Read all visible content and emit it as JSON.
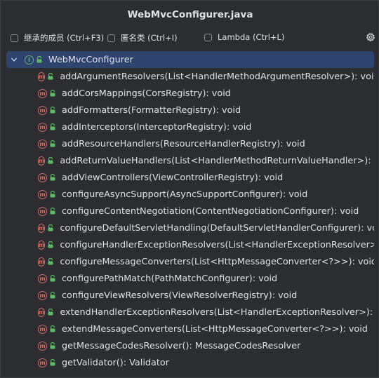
{
  "window": {
    "title": "WebMvcConfigurer.java"
  },
  "options": {
    "inherited": "继承的成员 (Ctrl+F3)",
    "anonymous": "匿名类 (Ctrl+I)",
    "lambda": "Lambda (Ctrl+L)"
  },
  "icons": {
    "class": "interface-icon",
    "method": "method-icon",
    "access": "public-lock-icon",
    "settings": "gear-icon"
  },
  "colors": {
    "selection": "#2e436e",
    "class_icon": "#5fb865",
    "method_icon": "#d86b60",
    "access_icon": "#5fb865"
  },
  "tree": {
    "root": {
      "badge": "I",
      "label": "WebMvcConfigurer"
    },
    "method_badge": "m",
    "methods": [
      "addArgumentResolvers(List<HandlerMethodArgumentResolver>): void",
      "addCorsMappings(CorsRegistry): void",
      "addFormatters(FormatterRegistry): void",
      "addInterceptors(InterceptorRegistry): void",
      "addResourceHandlers(ResourceHandlerRegistry): void",
      "addReturnValueHandlers(List<HandlerMethodReturnValueHandler>): void",
      "addViewControllers(ViewControllerRegistry): void",
      "configureAsyncSupport(AsyncSupportConfigurer): void",
      "configureContentNegotiation(ContentNegotiationConfigurer): void",
      "configureDefaultServletHandling(DefaultServletHandlerConfigurer): void",
      "configureHandlerExceptionResolvers(List<HandlerExceptionResolver>): void",
      "configureMessageConverters(List<HttpMessageConverter<?>>): void",
      "configurePathMatch(PathMatchConfigurer): void",
      "configureViewResolvers(ViewResolverRegistry): void",
      "extendHandlerExceptionResolvers(List<HandlerExceptionResolver>): void",
      "extendMessageConverters(List<HttpMessageConverter<?>>): void",
      "getMessageCodesResolver(): MessageCodesResolver",
      "getValidator(): Validator"
    ]
  }
}
